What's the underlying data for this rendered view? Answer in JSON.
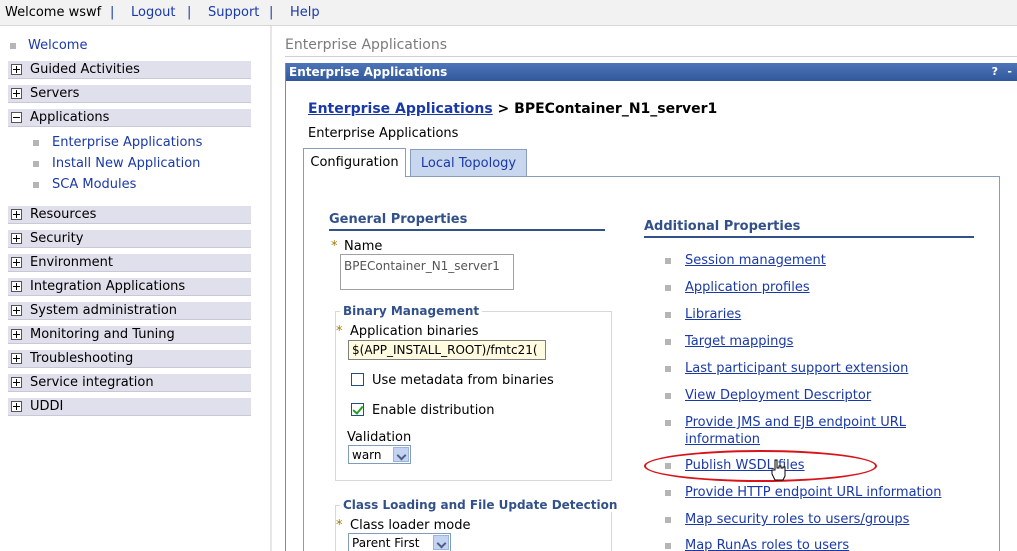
{
  "topbar": {
    "welcome": "Welcome wswf",
    "sep": "|",
    "links": [
      "Logout",
      "Support",
      "Help"
    ]
  },
  "nav": {
    "welcome": "Welcome",
    "items": [
      {
        "label": "Guided Activities"
      },
      {
        "label": "Servers"
      },
      {
        "label": "Applications"
      },
      {
        "label": "Resources"
      },
      {
        "label": "Security"
      },
      {
        "label": "Environment"
      },
      {
        "label": "Integration Applications"
      },
      {
        "label": "System administration"
      },
      {
        "label": "Monitoring and Tuning"
      },
      {
        "label": "Troubleshooting"
      },
      {
        "label": "Service integration"
      },
      {
        "label": "UDDI"
      }
    ],
    "applications_sub": [
      "Enterprise Applications",
      "Install New Application",
      "SCA Modules"
    ]
  },
  "main": {
    "page_title": "Enterprise Applications",
    "panel_title": "Enterprise Applications",
    "panel_help": "?",
    "panel_min": "-",
    "breadcrumb_link": "Enterprise Applications",
    "breadcrumb_sep": " > ",
    "breadcrumb_current": "BPEContainer_N1_server1",
    "subtitle": "Enterprise Applications",
    "tabs": [
      "Configuration",
      "Local Topology"
    ]
  },
  "general": {
    "heading": "General Properties",
    "required": "*",
    "name_label": "Name",
    "name_value": "BPEContainer_N1_server1",
    "binary_legend": "Binary Management",
    "app_binaries_label": "Application binaries",
    "app_binaries_value": "$(APP_INSTALL_ROOT)/fmtc21(",
    "use_metadata_label": "Use metadata from binaries",
    "enable_distribution_label": "Enable distribution",
    "validation_label": "Validation",
    "validation_value": "warn",
    "class_legend": "Class Loading and File Update Detection",
    "class_loader_label": "Class loader mode",
    "class_loader_value": "Parent First"
  },
  "additional": {
    "heading": "Additional Properties",
    "links": [
      "Session management",
      "Application profiles",
      "Libraries",
      "Target mappings",
      "Last participant support extension",
      "View Deployment Descriptor",
      "Provide JMS and EJB endpoint URL",
      "information",
      "Publish WSDL files",
      "Provide HTTP endpoint URL information",
      "Map security roles to users/groups",
      "Map RunAs roles to users"
    ]
  },
  "colors": {
    "link": "#1a39a8",
    "panel_bar": "#30589b",
    "highlight": "#d8141a"
  },
  "icons": {
    "nav_expand": "plus-box-icon",
    "nav_collapse": "minus-box-icon",
    "cursor": "hand-pointer-icon"
  }
}
